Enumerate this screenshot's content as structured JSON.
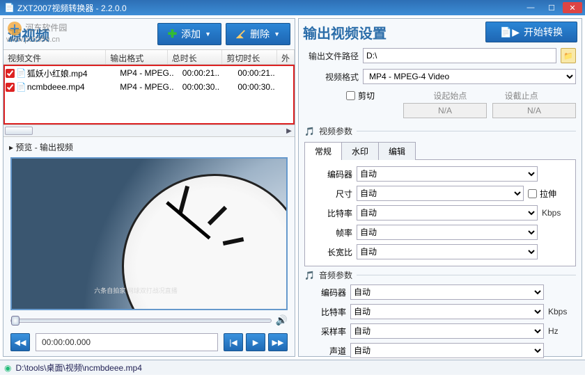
{
  "window": {
    "title": "ZXT2007视频转换器 - 2.2.0.0"
  },
  "watermark": {
    "text": "河东软件园",
    "url": "www.pc0359.cn"
  },
  "left": {
    "heading": "源视频",
    "add_btn": "添加",
    "del_btn": "删除",
    "columns": {
      "file": "视频文件",
      "format": "输出格式",
      "duration": "总时长",
      "clip": "剪切时长",
      "ext": "外"
    },
    "rows": [
      {
        "file": "狐妖小红娘.mp4",
        "format": "MP4 - MPEG..",
        "duration": "00:00:21..",
        "clip": "00:00:21..",
        "checked": true
      },
      {
        "file": "ncmbdeee.mp4",
        "format": "MP4 - MPEG..",
        "duration": "00:00:30..",
        "clip": "00:00:30..",
        "checked": true
      }
    ],
    "preview_label": "▸ 预览 - 输出视频",
    "clock_caption": "六条自拍家 网球双打战况直播",
    "time_display": "00:00:00.000"
  },
  "right": {
    "heading": "输出视频设置",
    "convert_btn": "开始转换",
    "path_label": "输出文件路径",
    "path_value": "D:\\",
    "fmt_label": "视频格式",
    "fmt_value": "MP4 - MPEG-4 Video",
    "clip_chk": "剪切",
    "clip_start": "设起始点",
    "clip_end": "设截止点",
    "na": "N/A",
    "video_section": "视频参数",
    "tabs": {
      "general": "常规",
      "watermark": "水印",
      "edit": "编辑"
    },
    "video": {
      "encoder_lbl": "编码器",
      "encoder_val": "自动",
      "size_lbl": "尺寸",
      "size_val": "自动",
      "stretch": "拉伸",
      "bitrate_lbl": "比特率",
      "bitrate_val": "自动",
      "bitrate_unit": "Kbps",
      "fps_lbl": "帧率",
      "fps_val": "自动",
      "aspect_lbl": "长宽比",
      "aspect_val": "自动"
    },
    "audio_section": "音频参数",
    "audio": {
      "encoder_lbl": "编码器",
      "encoder_val": "自动",
      "bitrate_lbl": "比特率",
      "bitrate_val": "自动",
      "bitrate_unit": "Kbps",
      "sample_lbl": "采样率",
      "sample_val": "自动",
      "sample_unit": "Hz",
      "channel_lbl": "声道",
      "channel_val": "自动"
    }
  },
  "status": "D:\\tools\\桌面\\视频\\ncmbdeee.mp4"
}
